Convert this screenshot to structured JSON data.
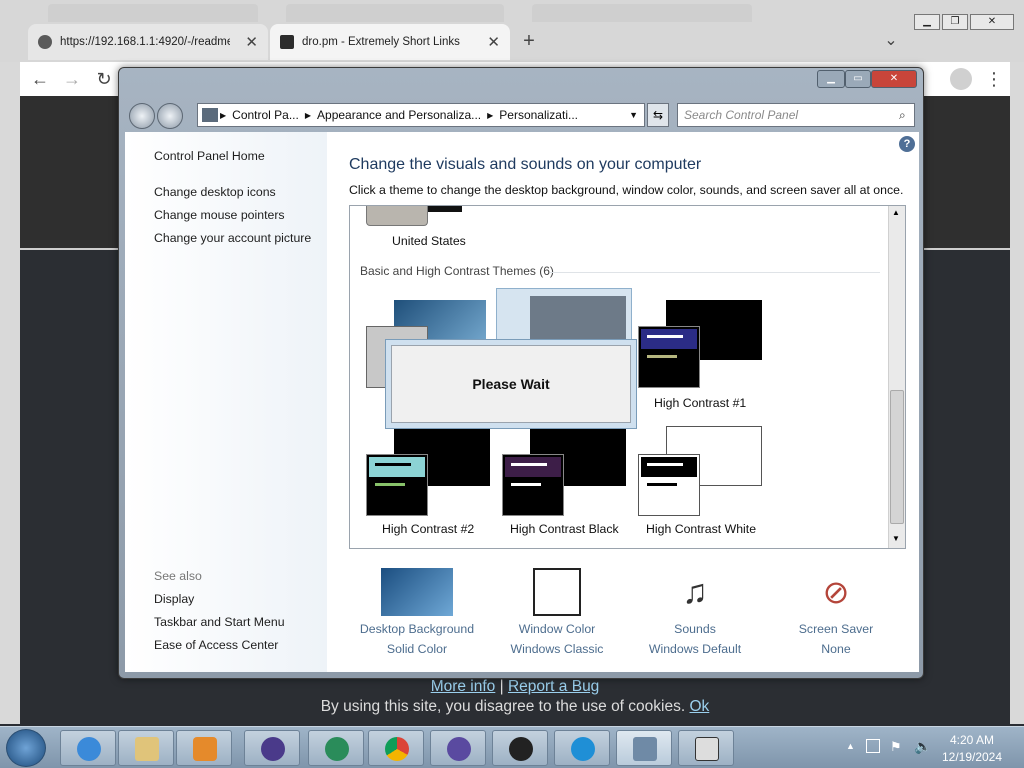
{
  "browser": {
    "background_tabs": [
      "",
      "",
      "",
      ""
    ],
    "tabs": [
      {
        "title": "https://192.168.1.1:4920/-/readme",
        "close": "✕"
      },
      {
        "title": "dro.pm - Extremely Short Links",
        "close": "✕"
      }
    ],
    "new_tab": "+",
    "tab_menu": "⌄"
  },
  "control_panel": {
    "breadcrumbs": [
      "Control Pa...",
      "Appearance and Personaliza...",
      "Personalizati..."
    ],
    "search_placeholder": "Search Control Panel",
    "left_links": [
      "Control Panel Home",
      "Change desktop icons",
      "Change mouse pointers",
      "Change your account picture"
    ],
    "see_also_title": "See also",
    "see_also": [
      "Display",
      "Taskbar and Start Menu",
      "Ease of Access Center"
    ],
    "heading": "Change the visuals and sounds on your computer",
    "subheading": "Click a theme to change the desktop background, window color, sounds, and screen saver all at once.",
    "top_theme_label": "United States",
    "group_label": "Basic and High Contrast Themes (6)",
    "themes": [
      "High Contrast #1",
      "High Contrast #2",
      "High Contrast Black",
      "High Contrast White"
    ],
    "dialog_text": "Please Wait",
    "bottom": [
      {
        "label": "Desktop Background",
        "value": "Solid Color"
      },
      {
        "label": "Window Color",
        "value": "Windows Classic"
      },
      {
        "label": "Sounds",
        "value": "Windows Default"
      },
      {
        "label": "Screen Saver",
        "value": "None"
      }
    ]
  },
  "page_footer": {
    "more_info": "More info",
    "separator": "|",
    "report": "Report a Bug",
    "cookie_text": "By using this site, you disagree to the use of cookies.",
    "ok": "Ok"
  },
  "taskbar": {
    "time": "4:20 AM",
    "date": "12/19/2024"
  }
}
